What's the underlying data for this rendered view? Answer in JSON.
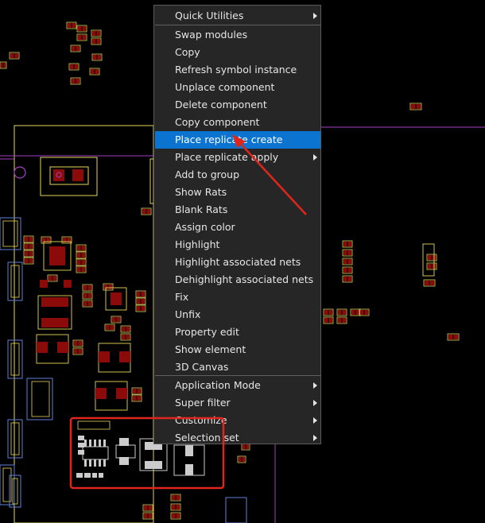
{
  "context_menu": {
    "items": [
      {
        "label": "Quick Utilities",
        "submenu": true
      },
      {
        "label": "Swap modules",
        "submenu": false
      },
      {
        "label": "Copy",
        "submenu": false
      },
      {
        "label": "Refresh symbol instance",
        "submenu": false
      },
      {
        "label": "Unplace component",
        "submenu": false
      },
      {
        "label": "Delete component",
        "submenu": false
      },
      {
        "label": "Copy component",
        "submenu": false
      },
      {
        "label": "Place replicate create",
        "submenu": false,
        "highlighted": true
      },
      {
        "label": "Place replicate apply",
        "submenu": true
      },
      {
        "label": "Add to group",
        "submenu": false
      },
      {
        "label": "Show Rats",
        "submenu": false
      },
      {
        "label": "Blank Rats",
        "submenu": false
      },
      {
        "label": "Assign color",
        "submenu": false
      },
      {
        "label": "Highlight",
        "submenu": false
      },
      {
        "label": "Highlight associated nets",
        "submenu": false
      },
      {
        "label": "Dehighlight associated nets",
        "submenu": false
      },
      {
        "label": "Fix",
        "submenu": false
      },
      {
        "label": "Unfix",
        "submenu": false
      },
      {
        "label": "Property edit",
        "submenu": false
      },
      {
        "label": "Show element",
        "submenu": false
      },
      {
        "label": "3D Canvas",
        "submenu": false
      },
      {
        "label": "Application Mode",
        "submenu": true
      },
      {
        "label": "Super filter",
        "submenu": true
      },
      {
        "label": "Customize",
        "submenu": true
      },
      {
        "label": "Selection set",
        "submenu": true
      }
    ]
  },
  "colors": {
    "canvas_bg": "#000000",
    "menu_bg": "#262626",
    "menu_highlight": "#0a74d0",
    "annotation_red": "#e0261c",
    "pcb_pad": "#8b0a0a",
    "pcb_outline": "#e6d45a",
    "pcb_board_edge": "#a040c0"
  }
}
